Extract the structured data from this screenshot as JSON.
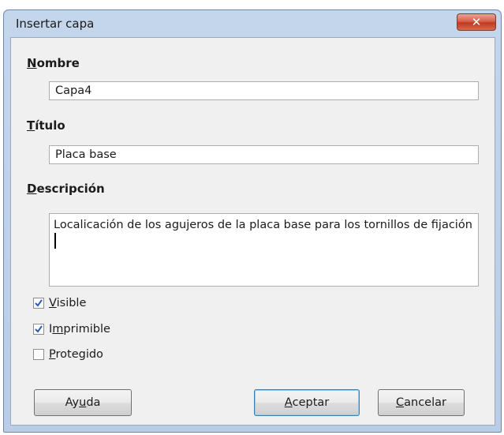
{
  "window": {
    "title": "Insertar capa"
  },
  "fields": {
    "name": {
      "label_mnemonic": "N",
      "label_rest": "ombre",
      "value": "Capa4"
    },
    "title": {
      "label_mnemonic": "T",
      "label_rest": "ítulo",
      "value": "Placa base"
    },
    "description": {
      "label_mnemonic": "D",
      "label_rest": "escripción",
      "value": "Localicación de los agujeros de la placa base para los tornillos de fijación"
    }
  },
  "checkboxes": [
    {
      "pre": "",
      "mnemonic": "V",
      "post": "isible",
      "checked": true
    },
    {
      "pre": "I",
      "mnemonic": "m",
      "post": "primible",
      "checked": true
    },
    {
      "pre": "",
      "mnemonic": "P",
      "post": "rotegido",
      "checked": false
    }
  ],
  "buttons": {
    "help": {
      "pre": "Ay",
      "mnemonic": "u",
      "post": "da"
    },
    "ok": {
      "pre": "",
      "mnemonic": "A",
      "post": "ceptar"
    },
    "cancel": {
      "pre": "",
      "mnemonic": "C",
      "post": "ancelar"
    }
  },
  "icons": {
    "close": "close-icon",
    "checkmark": "checkmark-icon"
  },
  "colors": {
    "close_button": "#c0391f",
    "checkmark": "#2a5bb8",
    "default_button_border": "#3c7fb1"
  }
}
